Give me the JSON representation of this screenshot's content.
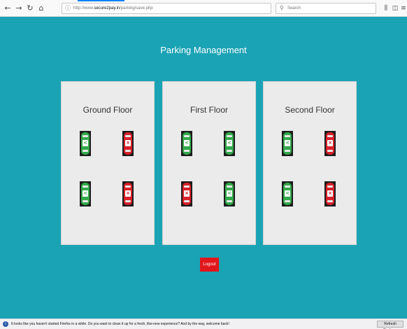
{
  "browser": {
    "url_prefix": "http://www.",
    "url_host": "secure2pay.in",
    "url_path": "/parking/save.php",
    "search_placeholder": "Search",
    "back_glyph": "←",
    "forward_glyph": "→",
    "reload_glyph": "↻",
    "home_glyph": "⌂",
    "library_glyph": "⫼",
    "sidebar_glyph": "◫",
    "menu_glyph": "≡"
  },
  "page": {
    "title": "Parking Management"
  },
  "floors": [
    {
      "name": "Ground Floor",
      "slots": [
        "free",
        "taken",
        "free",
        "taken"
      ]
    },
    {
      "name": "First Floor",
      "slots": [
        "free",
        "free",
        "taken",
        "free"
      ]
    },
    {
      "name": "Second Floor",
      "slots": [
        "free",
        "taken",
        "free",
        "taken"
      ]
    }
  ],
  "badges": {
    "free": "<",
    "taken": "×"
  },
  "logout_label": "Logout",
  "notification": {
    "message": "It looks like you haven't started Firefox in a while. Do you want to clean it up for a fresh, like-new experience? And by the way, welcome back!",
    "button_label": "Refresh Firefox..."
  },
  "colors": {
    "background": "#1aa3b5",
    "free_slot": "#33a94b",
    "taken_slot": "#d82029",
    "logout": "#e2171c"
  }
}
